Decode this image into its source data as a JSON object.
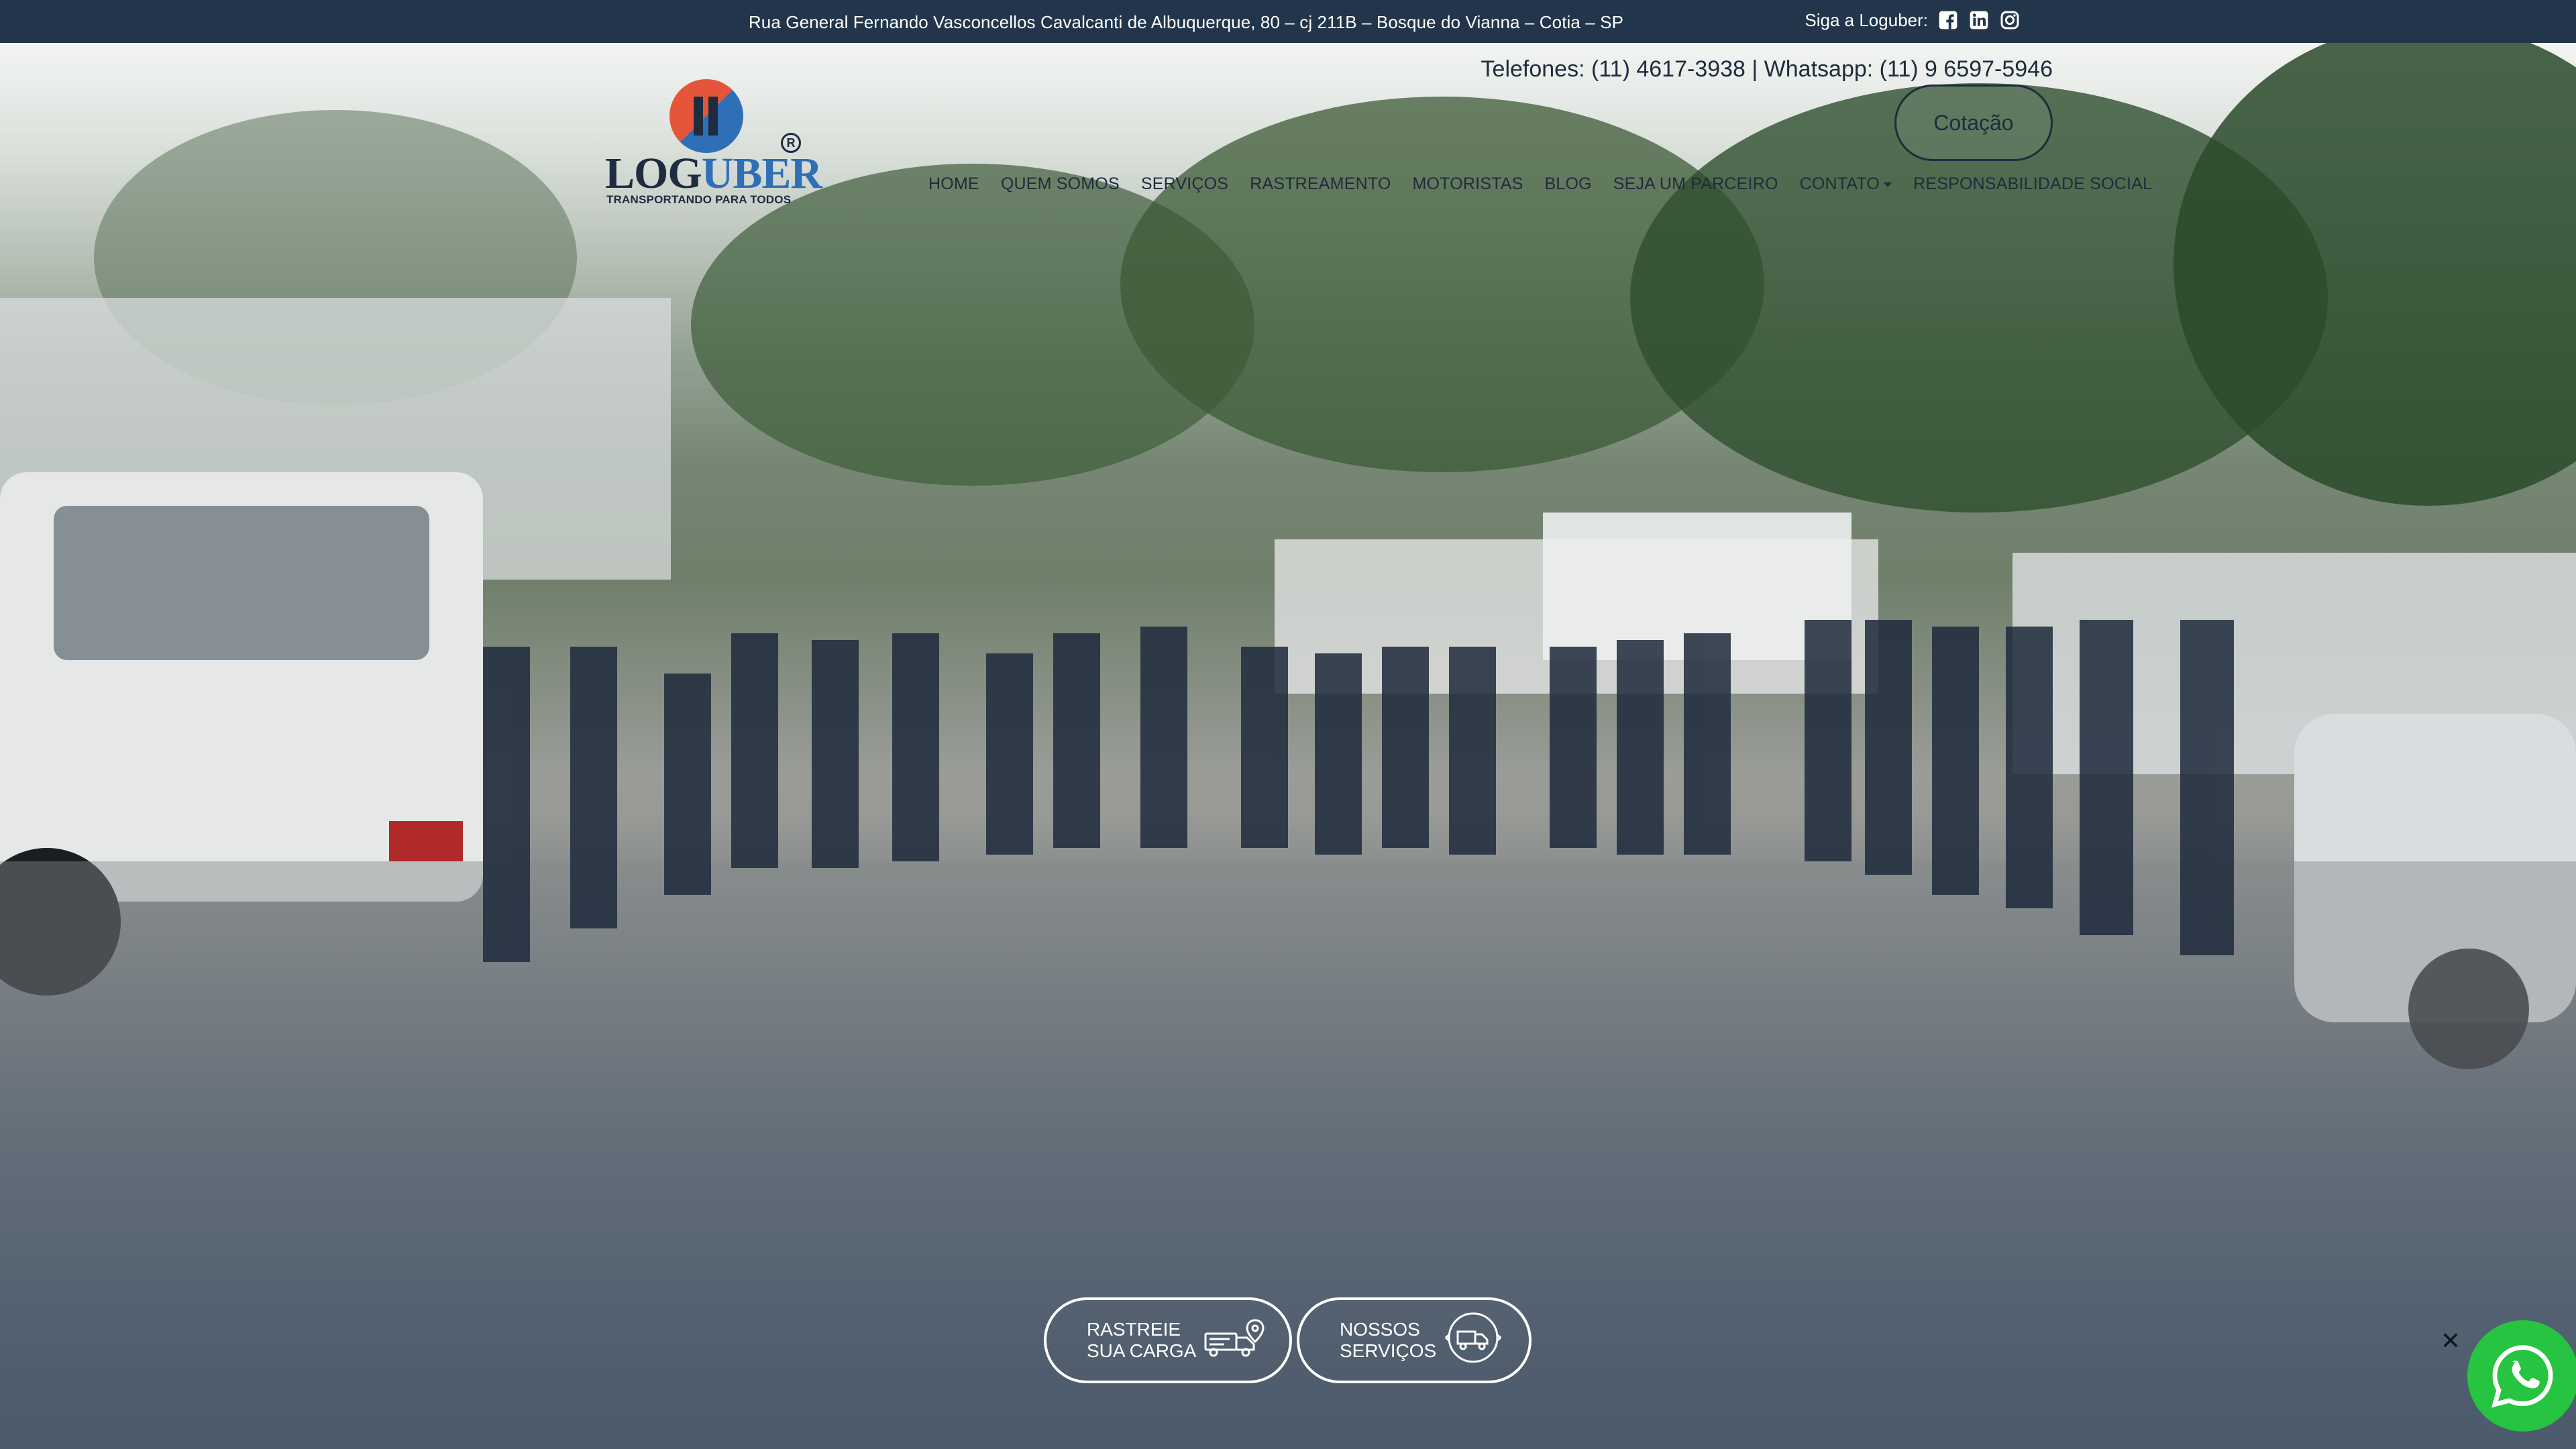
{
  "topbar": {
    "address": "Rua General Fernando Vasconcellos Cavalcanti de Albuquerque, 80 – cj 211B – Bosque do Vianna – Cotia – SP",
    "follow_label": "Siga a Loguber:",
    "social_icons": [
      "facebook-icon",
      "linkedin-icon",
      "instagram-icon"
    ]
  },
  "header": {
    "logo": {
      "text_dark": "LOG",
      "text_blue": "UBER",
      "registered": "R",
      "tagline": "TRANSPORTANDO PARA TODOS"
    },
    "phones": "Telefones: (11) 4617-3938 | Whatsapp: (11) 9 6597-5946",
    "quote_button": "Cotação"
  },
  "nav": {
    "items": [
      {
        "label": "HOME"
      },
      {
        "label": "QUEM SOMOS"
      },
      {
        "label": "SERVIÇOS"
      },
      {
        "label": "RASTREAMENTO"
      },
      {
        "label": "MOTORISTAS"
      },
      {
        "label": "BLOG"
      },
      {
        "label": "SEJA UM PARCEIRO"
      },
      {
        "label": "CONTATO",
        "dropdown": true
      },
      {
        "label": "RESPONSABILIDADE SOCIAL"
      }
    ]
  },
  "cta": {
    "track": "RASTREIE\nSUA CARGA",
    "services": "NOSSOS\nSERVIÇOS"
  },
  "colors": {
    "topbar_bg": "#22354a",
    "text_dark": "#1d2c3d",
    "brand_blue": "#2f6fb6",
    "brand_red": "#e5553a",
    "whatsapp_green": "#26c440"
  }
}
